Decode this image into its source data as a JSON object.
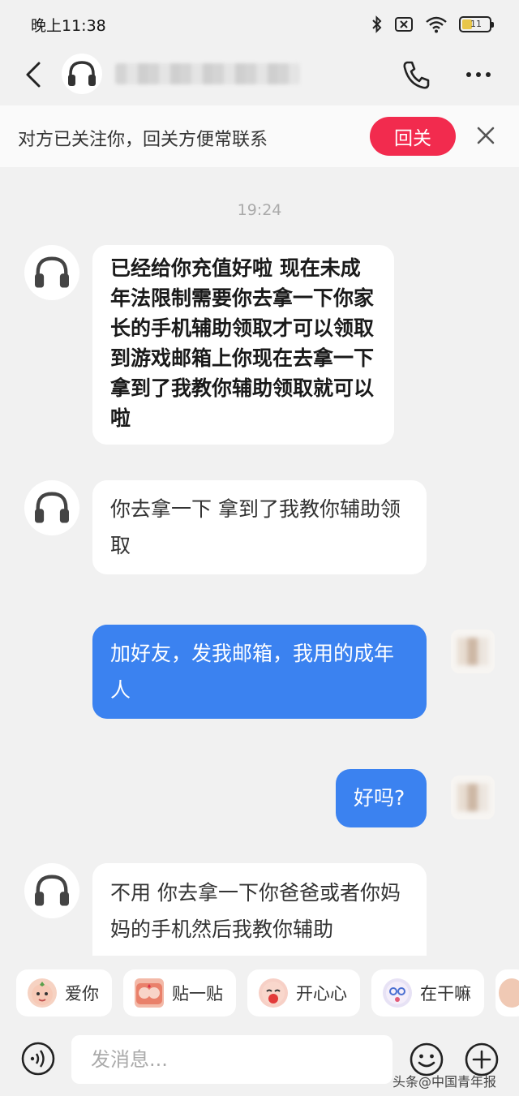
{
  "status_bar": {
    "time": "晚上11:38",
    "battery_level": "11"
  },
  "header": {
    "name_blurred": true
  },
  "follow_bar": {
    "text": "对方已关注你，回关方便常联系",
    "button": "回关"
  },
  "chat": {
    "timestamp": "19:24",
    "messages": [
      {
        "side": "left",
        "text": "已经给你充值好啦 现在未成年法限制需要你去拿一下你家长的手机辅助领取才可以领取到游戏邮箱上你现在去拿一下 拿到了我教你辅助领取就可以啦"
      },
      {
        "side": "left",
        "text": "你去拿一下 拿到了我教你辅助领取"
      },
      {
        "side": "right",
        "text": "加好友，发我邮箱，我用的成年人"
      },
      {
        "side": "right",
        "text": "好吗?"
      },
      {
        "side": "left",
        "text": "不用 你去拿一下你爸爸或者你妈妈的手机然后我教你辅助"
      }
    ]
  },
  "quick_replies": [
    "爱你",
    "贴一贴",
    "开心心",
    "在干嘛"
  ],
  "input": {
    "placeholder": "发消息..."
  },
  "watermark": "头条@中国青年报",
  "colors": {
    "accent_red": "#f22b4e",
    "outgoing_bubble": "#3b82f0",
    "background": "#f1f1f1"
  }
}
